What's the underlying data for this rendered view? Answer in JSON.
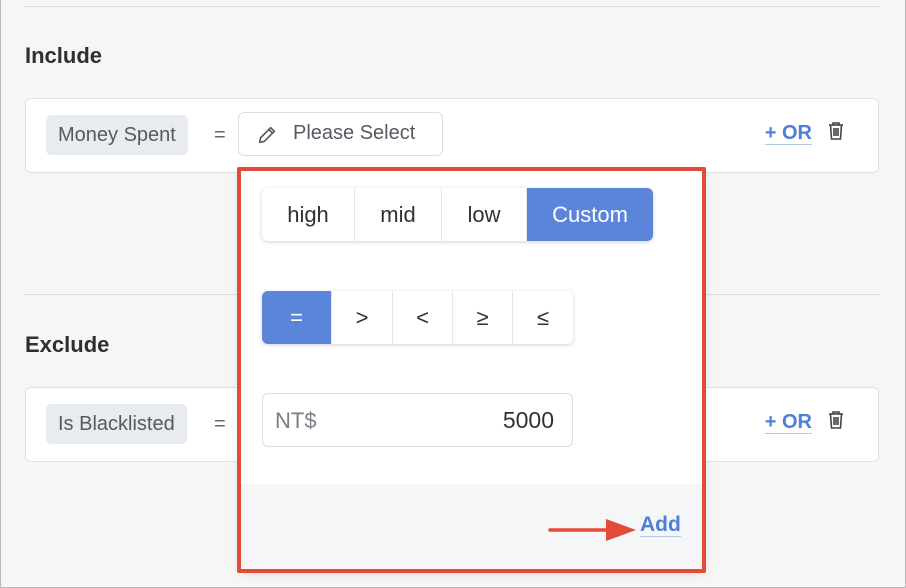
{
  "include": {
    "title": "Include",
    "rule": {
      "field": "Money Spent",
      "operator": "=",
      "select_placeholder": "Please Select",
      "or_label": "+ OR"
    }
  },
  "exclude": {
    "title": "Exclude",
    "rule": {
      "field": "Is Blacklisted",
      "operator": "=",
      "or_label": "+ OR"
    }
  },
  "popover": {
    "levels": [
      "high",
      "mid",
      "low",
      "Custom"
    ],
    "selected_level": "Custom",
    "operators": [
      "=",
      ">",
      "<",
      "≥",
      "≤"
    ],
    "selected_operator": "=",
    "amount_prefix": "NT$",
    "amount_value": "5000",
    "add_label": "Add"
  },
  "colors": {
    "accent": "#5b85db",
    "link": "#4f7fd6",
    "highlight": "#e34a37"
  },
  "icons": {
    "select": "pencil-icon",
    "delete": "trash-icon",
    "annotation": "arrow-right-icon"
  }
}
